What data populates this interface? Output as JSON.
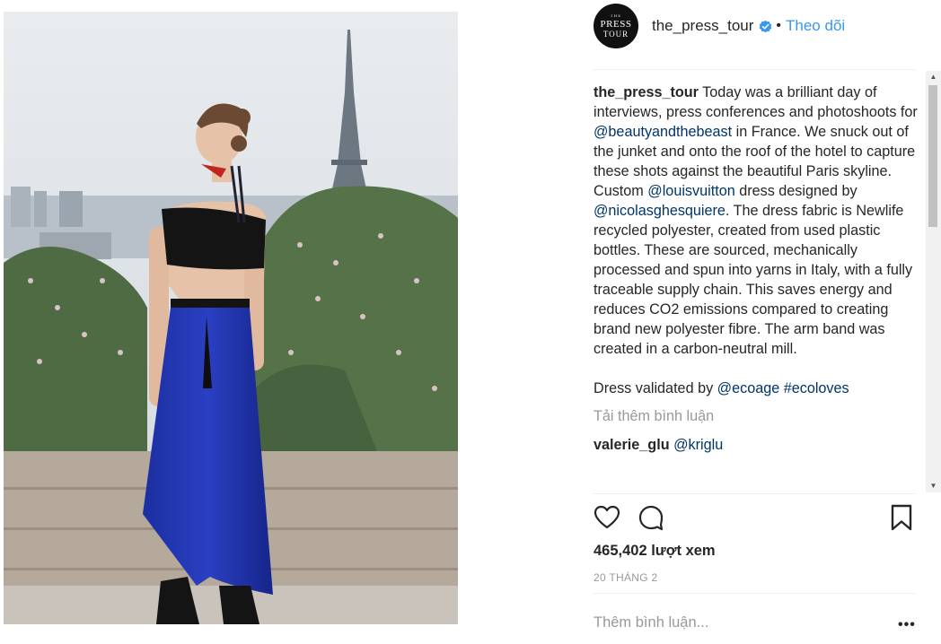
{
  "post": {
    "username": "the_press_tour",
    "follow_label": "Theo dõi",
    "separator": "•",
    "avatar": {
      "line1": "THE",
      "line2": "PRESS",
      "line3": "TOUR"
    }
  },
  "caption": {
    "username": "the_press_tour",
    "part1": " Today was a brilliant day of interviews, press conferences and photoshoots for ",
    "mention1": "@beautyandthebeast",
    "part2": " in France. We snuck out of the junket and onto the roof of the hotel to capture these shots against the beautiful Paris skyline.",
    "part3": "Custom ",
    "mention2": "@louisvuitton",
    "part4": " dress designed by ",
    "mention3": "@nicolasghesquiere",
    "part5": ". The dress fabric is Newlife recycled polyester, created from used plastic bottles. These are sourced, mechanically processed and spun into yarns in Italy, with a fully traceable supply chain. This saves energy and reduces CO2 emissions compared to creating brand new polyester fibre. The arm band was created in a carbon-neutral mill.",
    "part6": "Dress validated by ",
    "mention4": "@ecoage",
    "hashtag": "#ecoloves"
  },
  "load_more": "Tải thêm bình luận",
  "first_comment": {
    "username": "valerie_glu",
    "text": "@kriglu"
  },
  "stats": {
    "views": "465,402 lượt xem",
    "date": "20 THÁNG 2"
  },
  "add_comment_placeholder": "Thêm bình luận...",
  "more_options": "•••",
  "icons": [
    "verified-badge-icon",
    "heart-icon",
    "comment-icon",
    "bookmark-icon",
    "more-options-icon"
  ],
  "colors": {
    "link": "#003569",
    "follow": "#3897f0",
    "verified": "#3897f0",
    "muted": "#999999"
  }
}
